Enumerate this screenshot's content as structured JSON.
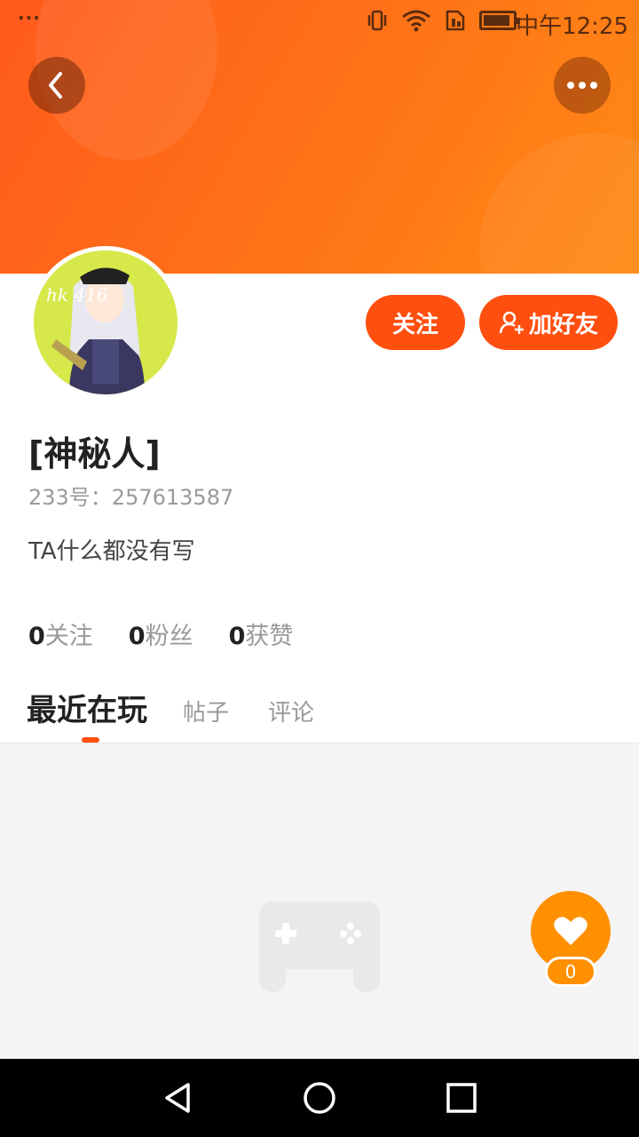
{
  "status_bar": {
    "dots": "···",
    "time": "中午12:25",
    "icons": [
      "vibrate-icon",
      "wifi-icon",
      "sim-icon",
      "battery-icon"
    ],
    "battery_level": 0.9
  },
  "header": {
    "back_icon": "chevron-left-icon",
    "more_icon": "more-horizontal-icon",
    "gradient_start": "#ff5a1c",
    "gradient_end": "#ff8a14"
  },
  "profile": {
    "avatar_text": "hk 416",
    "name": "[神秘人]",
    "uid_label": "233号：257613587",
    "bio": "TA什么都没有写",
    "follow_label": "关注",
    "add_friend_label": "加好友"
  },
  "stats": [
    {
      "count": "0",
      "label": "关注"
    },
    {
      "count": "0",
      "label": "粉丝"
    },
    {
      "count": "0",
      "label": "获赞"
    }
  ],
  "tabs": [
    {
      "label": "最近在玩",
      "active": true
    },
    {
      "label": "帖子",
      "active": false
    },
    {
      "label": "评论",
      "active": false
    }
  ],
  "empty_state": {
    "icon": "game-controller-icon"
  },
  "like": {
    "icon": "heart-icon",
    "count": "0"
  },
  "colors": {
    "accent": "#ff4f0f",
    "like": "#ff9000"
  },
  "navigation_bar": {
    "icons": [
      "back-triangle-icon",
      "home-circle-icon",
      "recents-square-icon"
    ]
  }
}
